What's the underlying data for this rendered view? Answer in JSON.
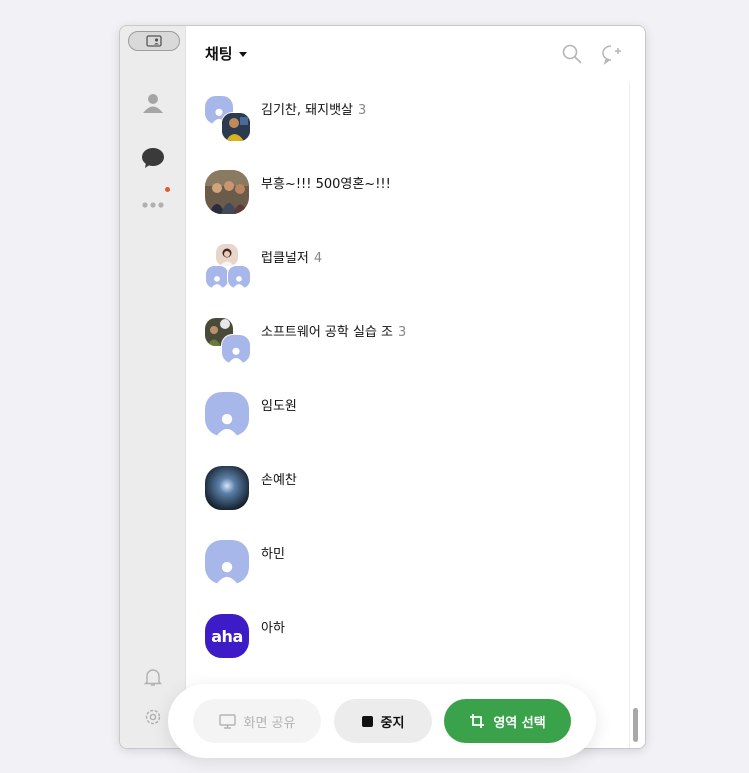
{
  "header": {
    "title": "채팅"
  },
  "chats": [
    {
      "name": "김기찬, 돼지뱃살",
      "count": "3",
      "avatar": "group-photo"
    },
    {
      "name": "부흥~!!! 500영혼~!!!",
      "count": "",
      "avatar": "photo-group-people"
    },
    {
      "name": "럽클널저",
      "count": "4",
      "avatar": "group-three"
    },
    {
      "name": "소프트웨어 공학 실습 조",
      "count": "3",
      "avatar": "group-photo-default"
    },
    {
      "name": "임도원",
      "count": "",
      "avatar": "default-person"
    },
    {
      "name": "손예찬",
      "count": "",
      "avatar": "photo-dark"
    },
    {
      "name": "하민",
      "count": "",
      "avatar": "default-person"
    },
    {
      "name": "아하",
      "count": "",
      "avatar": "aha-logo"
    }
  ],
  "aha_logo_text": "aha",
  "bottom_bar": {
    "share_label": "화면 공유",
    "stop_label": "중지",
    "area_label": "영역 선택"
  },
  "colors": {
    "accent_green": "#3aa24a",
    "avatar_default": "#a8b7ea",
    "aha_brand": "#3d1cc8",
    "badge_dot": "#e25c2a"
  },
  "icons": [
    "profile-switch-icon",
    "friends-icon",
    "chat-icon",
    "more-icon",
    "bell-icon",
    "settings-icon",
    "search-icon",
    "new-chat-icon",
    "screen-share-icon",
    "stop-icon",
    "crop-icon"
  ]
}
